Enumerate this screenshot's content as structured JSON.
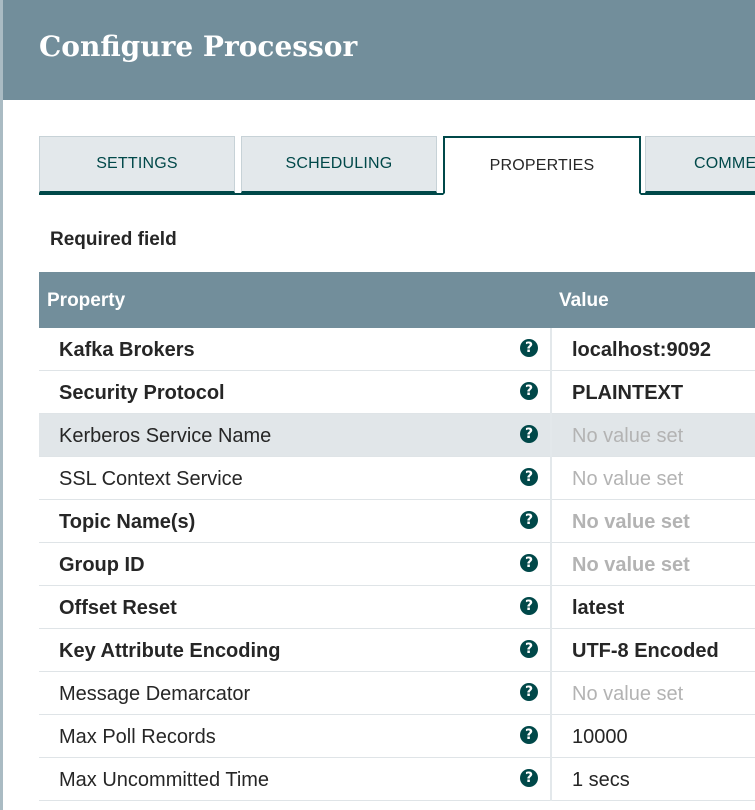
{
  "header": {
    "title": "Configure Processor"
  },
  "tabs": [
    {
      "label": "SETTINGS",
      "active": false
    },
    {
      "label": "SCHEDULING",
      "active": false
    },
    {
      "label": "PROPERTIES",
      "active": true
    },
    {
      "label": "COMMENTS",
      "active": false
    }
  ],
  "required_label": "Required field",
  "grid": {
    "columns": [
      "Property",
      "Value"
    ],
    "rows": [
      {
        "name": "Kafka Brokers",
        "value": "localhost:9092",
        "required": true,
        "set": true
      },
      {
        "name": "Security Protocol",
        "value": "PLAINTEXT",
        "required": true,
        "set": true
      },
      {
        "name": "Kerberos Service Name",
        "value": "No value set",
        "required": false,
        "set": false
      },
      {
        "name": "SSL Context Service",
        "value": "No value set",
        "required": false,
        "set": false
      },
      {
        "name": "Topic Name(s)",
        "value": "No value set",
        "required": true,
        "set": false
      },
      {
        "name": "Group ID",
        "value": "No value set",
        "required": true,
        "set": false
      },
      {
        "name": "Offset Reset",
        "value": "latest",
        "required": true,
        "set": true
      },
      {
        "name": "Key Attribute Encoding",
        "value": "UTF-8 Encoded",
        "required": true,
        "set": true
      },
      {
        "name": "Message Demarcator",
        "value": "No value set",
        "required": false,
        "set": false
      },
      {
        "name": "Max Poll Records",
        "value": "10000",
        "required": false,
        "set": true
      },
      {
        "name": "Max Uncommitted Time",
        "value": "1 secs",
        "required": false,
        "set": true
      }
    ],
    "selected_row": 2
  },
  "icons": {
    "help": "question-circle-icon",
    "help_glyph": "?"
  },
  "colors": {
    "header_bg": "#728e9b",
    "accent": "#004849",
    "tab_inactive_bg": "#e3e8eb",
    "unset_value": "#b3b3b3",
    "selected_row_bg": "#e1e6e9"
  }
}
